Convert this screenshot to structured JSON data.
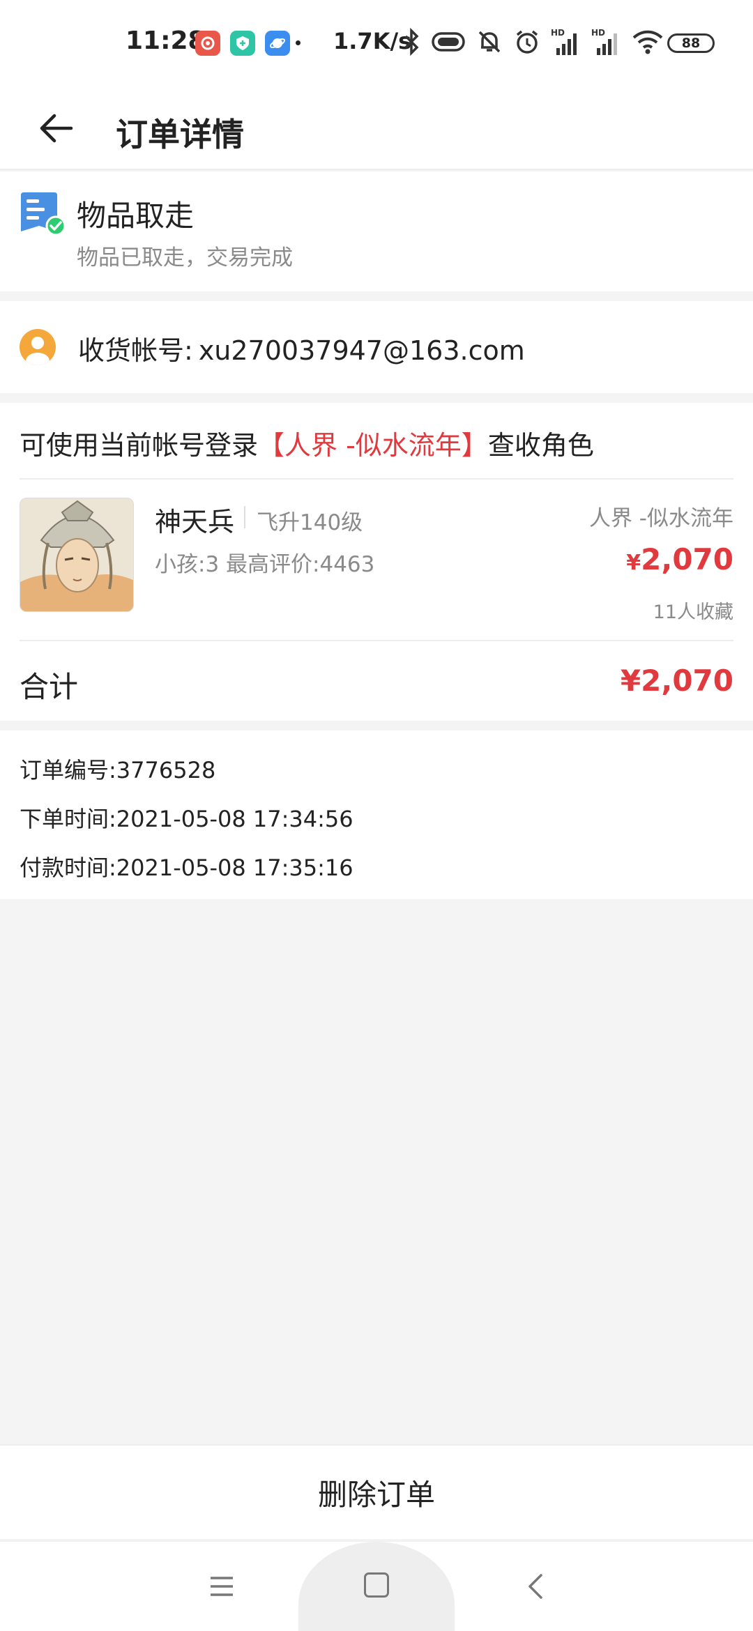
{
  "statusbar": {
    "time": "11:28",
    "net_speed": "1.7K/s",
    "battery": "88",
    "icons": [
      "netease-music-app-icon",
      "security-app-icon",
      "browser-app-icon",
      "bluetooth-icon",
      "vibrate-icon",
      "mute-icon",
      "alarm-icon",
      "signal-hd-1-icon",
      "signal-hd-2-icon",
      "wifi-icon"
    ]
  },
  "header": {
    "title": "订单详情"
  },
  "status": {
    "title": "物品取走",
    "subtitle": "物品已取走，交易完成"
  },
  "account": {
    "label": "收货帐号:",
    "value": "xu270037947@163.com"
  },
  "item": {
    "login_tip_prefix": "可使用当前帐号登录",
    "login_tip_server": "【人界 -似水流年】",
    "login_tip_suffix": "查收角色",
    "name": "神天兵",
    "level": "飞升140级",
    "stats": "小孩:3 最高评价:4463",
    "server": "人界 -似水流年",
    "price_symbol": "¥",
    "price": "2,070",
    "favorites": "11人收藏"
  },
  "total": {
    "label": "合计",
    "value": "¥2,070"
  },
  "order": {
    "number": "订单编号:3776528",
    "created": "下单时间:2021-05-08 17:34:56",
    "paid": "付款时间:2021-05-08 17:35:16"
  },
  "actions": {
    "delete_label": "删除订单"
  },
  "colors": {
    "accent_red": "#e0393e",
    "secondary_text": "#8a8a8a",
    "status_blue": "#4a90e2",
    "check_green": "#2ecc71",
    "avatar_orange": "#f4a73a"
  }
}
